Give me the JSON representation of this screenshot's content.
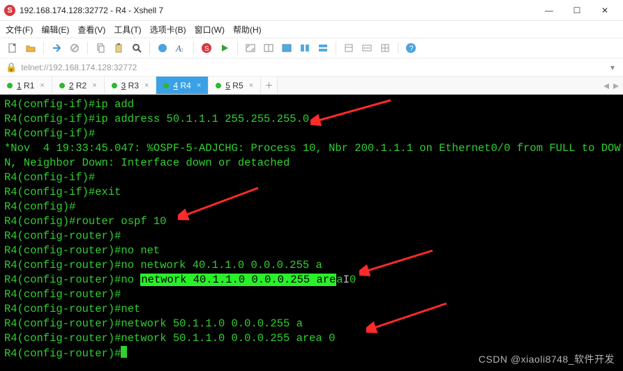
{
  "title": "192.168.174.128:32772 - R4 - Xshell 7",
  "menus": {
    "file": "文件(F)",
    "edit": "编辑(E)",
    "view": "查看(V)",
    "tools": "工具(T)",
    "tabs": "选项卡(B)",
    "window": "窗口(W)",
    "help": "帮助(H)"
  },
  "toolbar_icons": {
    "new": "new-file-icon",
    "open": "open-folder-icon",
    "connect": "connect-icon",
    "disconnect": "disconnect-icon",
    "copy": "copy-icon",
    "paste": "paste-icon",
    "find": "find-icon",
    "color": "color-icon",
    "font": "font-icon",
    "shell": "shell-icon",
    "run": "run-icon",
    "full": "fullscreen-icon",
    "split": "split-icon",
    "tile1": "tile1-icon",
    "tile2": "tile2-icon",
    "tile3": "tile3-icon",
    "optA": "optA-icon",
    "optB": "optB-icon",
    "optC": "optC-icon",
    "help": "help-icon"
  },
  "address": {
    "scheme": "telnet://",
    "host": "192.168.174.128:32772"
  },
  "tabs": [
    {
      "label_u": "1",
      "label_rest": " R1",
      "active": false
    },
    {
      "label_u": "2",
      "label_rest": " R2",
      "active": false
    },
    {
      "label_u": "3",
      "label_rest": " R3",
      "active": false
    },
    {
      "label_u": "4",
      "label_rest": " R4",
      "active": true
    },
    {
      "label_u": "5",
      "label_rest": " R5",
      "active": false
    }
  ],
  "terminal_lines": [
    {
      "text": "R4(config-if)#ip add"
    },
    {
      "text": "R4(config-if)#ip address 50.1.1.1 255.255.255.0"
    },
    {
      "text": "R4(config-if)#"
    },
    {
      "text": "*Nov  4 19:33:45.047: %OSPF-5-ADJCHG: Process 10, Nbr 200.1.1.1 on Ethernet0/0 from FULL to DOW"
    },
    {
      "text": "N, Neighbor Down: Interface down or detached"
    },
    {
      "text": "R4(config-if)#"
    },
    {
      "text": "R4(config-if)#exit"
    },
    {
      "text": "R4(config)#"
    },
    {
      "text": "R4(config)#router ospf 10"
    },
    {
      "text": "R4(config-router)#"
    },
    {
      "text": "R4(config-router)#no net"
    },
    {
      "text": "R4(config-router)#no network 40.1.1.0 0.0.0.255 a"
    },
    {
      "prefix": "R4(config-router)#no ",
      "hl": "network 40.1.1.0 0.0.0.255 are",
      "tail_a": "a",
      "caret": "I",
      "tail_zero": "0"
    },
    {
      "text": "R4(config-router)#"
    },
    {
      "text": "R4(config-router)#net"
    },
    {
      "text": "R4(config-router)#network 50.1.1.0 0.0.0.255 a"
    },
    {
      "text": "R4(config-router)#network 50.1.1.0 0.0.0.255 area 0"
    },
    {
      "text": "R4(config-router)#",
      "cursor": true
    }
  ],
  "window_buttons": {
    "min": "—",
    "max": "☐",
    "close": "✕"
  },
  "watermark": "CSDN @xiaoli8748_软件开发"
}
